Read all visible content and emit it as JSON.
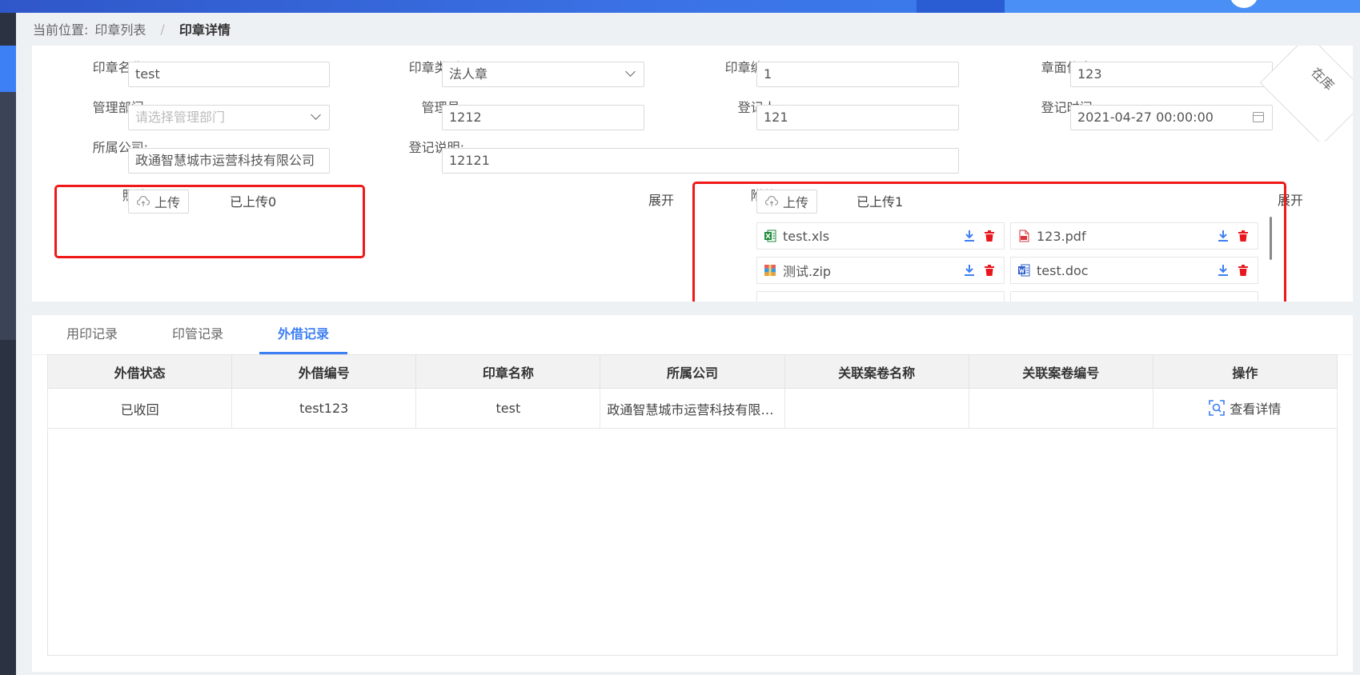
{
  "breadcrumb": {
    "prefix": "当前位置:",
    "list": "印章列表",
    "separator": "/",
    "current": "印章详情"
  },
  "form": {
    "seal_name": {
      "label": "印章名称:",
      "value": "test"
    },
    "seal_type": {
      "label": "印章类型:",
      "value": "法人章"
    },
    "seal_no": {
      "label": "印章编号:",
      "value": "1"
    },
    "seal_face": {
      "label": "章面信息:",
      "value": "123"
    },
    "dept": {
      "label": "管理部门:",
      "placeholder": "请选择管理部门"
    },
    "admin": {
      "label": "管理员:",
      "value": "1212"
    },
    "registrant": {
      "label": "登记人:",
      "value": "121"
    },
    "reg_time": {
      "label": "登记时间:",
      "value": "2021-04-27 00:00:00"
    },
    "company": {
      "label": "所属公司:",
      "value": "政通智慧城市运营科技有限公司"
    },
    "reg_note": {
      "label": "登记说明:",
      "value": "12121"
    }
  },
  "status_ribbon": "在库",
  "photo": {
    "label": "照片:",
    "upload_label": "上传",
    "uploaded_text": "已上传0",
    "expand_label": "展开"
  },
  "attachment": {
    "label": "附件:",
    "upload_label": "上传",
    "uploaded_text": "已上传1",
    "expand_label": "展开",
    "files": [
      {
        "name": "test.xls",
        "icon": "excel-icon",
        "color": "#1e8a3a"
      },
      {
        "name": "123.pdf",
        "icon": "pdf-icon",
        "color": "#d9363e"
      },
      {
        "name": "测试.zip",
        "icon": "zip-icon",
        "color": "#e8a03a"
      },
      {
        "name": "test.doc",
        "icon": "word-icon",
        "color": "#2b5cc9"
      }
    ]
  },
  "tabs": [
    "用印记录",
    "印管记录",
    "外借记录"
  ],
  "active_tab": "外借记录",
  "table": {
    "headers": [
      "外借状态",
      "外借编号",
      "印章名称",
      "所属公司",
      "关联案卷名称",
      "关联案卷编号",
      "操作"
    ],
    "rows": [
      {
        "status": "已收回",
        "no": "test123",
        "seal": "test",
        "company": "政通智慧城市运营科技有限公司",
        "case_name": "",
        "case_no": "",
        "action": "查看详情"
      }
    ]
  },
  "colors": {
    "accent": "#3d7ff5",
    "highlight_box": "#f01818",
    "download": "#3d7ff5",
    "delete": "#e8161e"
  }
}
